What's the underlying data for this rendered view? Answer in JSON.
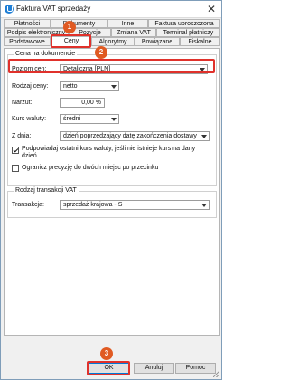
{
  "window": {
    "title": "Faktura VAT sprzedaży",
    "close_glyph": "✕"
  },
  "tabs": {
    "row1": [
      "Płatności",
      "Dokumenty",
      "Inne",
      "Faktura uproszczona"
    ],
    "row2": [
      "Podpis elektroniczny",
      "Pozycje",
      "Zmiana VAT",
      "Terminal płatniczy"
    ],
    "row3": [
      "Podstawowe",
      "Ceny",
      "Algorytmy",
      "Powiązane",
      "Fiskalne"
    ],
    "active": "Ceny"
  },
  "price_group": {
    "title": "Cena na dokumencie",
    "poziom_cen": {
      "label": "Poziom cen:",
      "value": "Detaliczna [PLN]"
    },
    "rodzaj_ceny": {
      "label": "Rodzaj ceny:",
      "value": "netto"
    },
    "narzut": {
      "label": "Narzut:",
      "value": "0,00 %"
    },
    "kurs_waluty": {
      "label": "Kurs waluty:",
      "value": "średni"
    },
    "z_dnia": {
      "label": "Z dnia:",
      "value": "dzień poprzedzający datę zakończenia dostawy"
    },
    "checkbox1": {
      "label": "Podpowiadaj ostatni kurs waluty, jeśli nie istnieje kurs na dany dzień",
      "checked": true
    },
    "checkbox2": {
      "label": "Ogranicz precyzję do dwóch miejsc po przecinku",
      "checked": false
    }
  },
  "transaction_group": {
    "title": "Rodzaj transakcji VAT",
    "transakcja": {
      "label": "Transakcja:",
      "value": "sprzedaż krajowa - S"
    }
  },
  "buttons": {
    "ok": "OK",
    "cancel": "Anuluj",
    "help": "Pomoc"
  },
  "markers": {
    "m1": "1",
    "m2": "2",
    "m3": "3"
  },
  "colors": {
    "highlight": "#e0312b",
    "marker": "#e05a22",
    "accent": "#0078d7"
  }
}
